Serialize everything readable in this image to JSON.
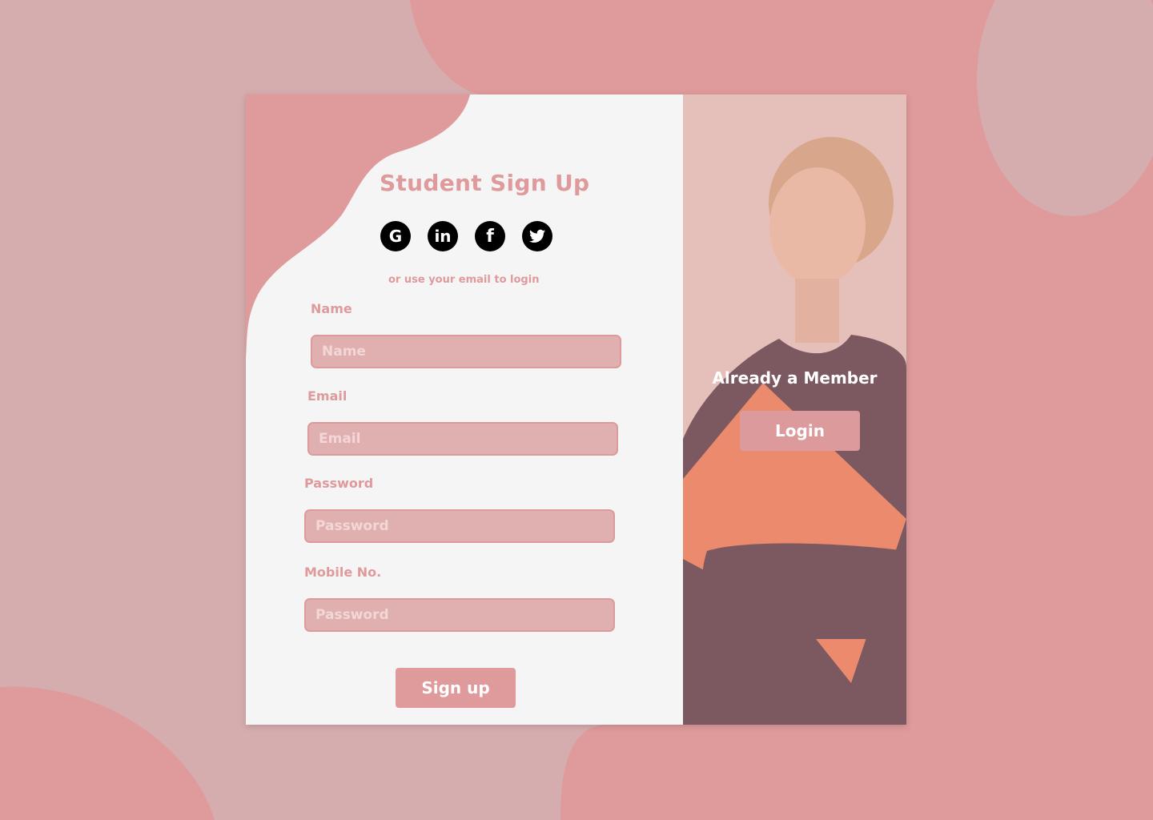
{
  "form": {
    "title": "Student Sign Up",
    "social": [
      {
        "icon": "google-icon",
        "glyph": "G"
      },
      {
        "icon": "linkedin-icon",
        "glyph": "in"
      },
      {
        "icon": "facebook-icon",
        "glyph": "f"
      },
      {
        "icon": "twitter-icon",
        "glyph": "🐦"
      }
    ],
    "or_text": "or use your email to login",
    "fields": [
      {
        "label": "Name",
        "placeholder": "Name"
      },
      {
        "label": "Email",
        "placeholder": "Email"
      },
      {
        "label": "Password",
        "placeholder": "Password"
      },
      {
        "label": "Mobile No.",
        "placeholder": "Password"
      }
    ],
    "submit": "Sign up"
  },
  "side": {
    "heading": "Already a Member",
    "login": "Login"
  },
  "colors": {
    "accent": "#df9a9b",
    "background": "#d6adae"
  }
}
